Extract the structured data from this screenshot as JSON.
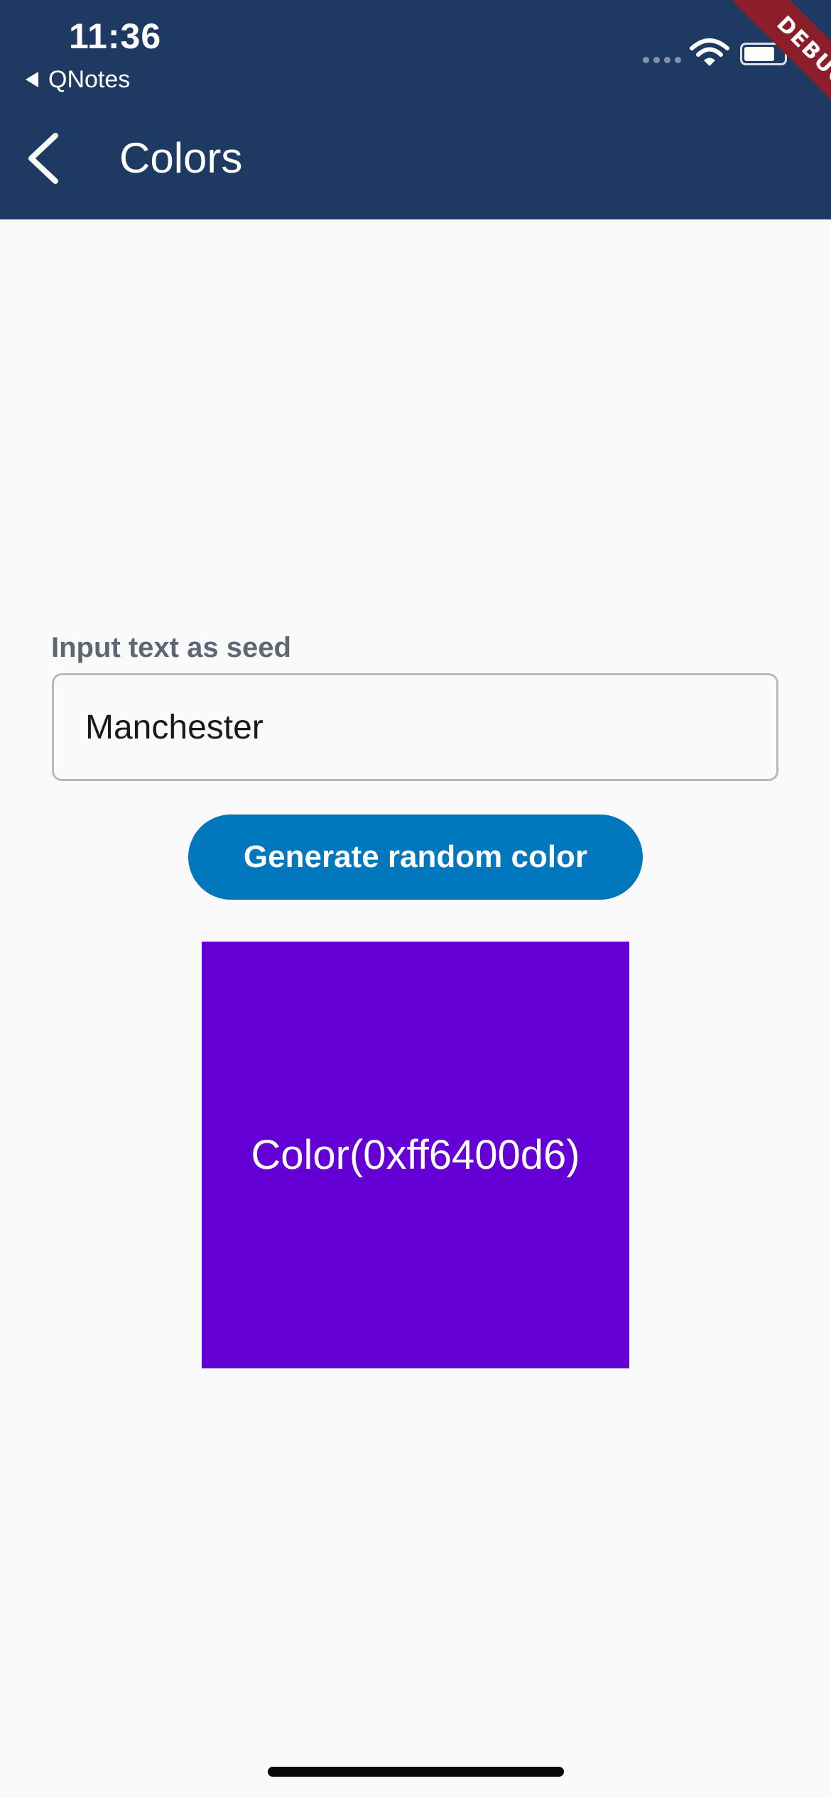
{
  "status_bar": {
    "time": "11:36",
    "back_app": "QNotes",
    "wifi_icon": "wifi-icon",
    "battery_icon": "battery-icon"
  },
  "debug_banner": {
    "label": "DEBUG"
  },
  "appbar": {
    "title": "Colors",
    "back_icon": "chevron-left-icon",
    "background": "#1f3a62"
  },
  "form": {
    "seed_label": "Input text as seed",
    "seed_value": "Manchester",
    "generate_button_label": "Generate random color",
    "button_color": "#0178bd"
  },
  "swatch": {
    "label": "Color(0xff6400d6)",
    "color": "#6400d6"
  }
}
